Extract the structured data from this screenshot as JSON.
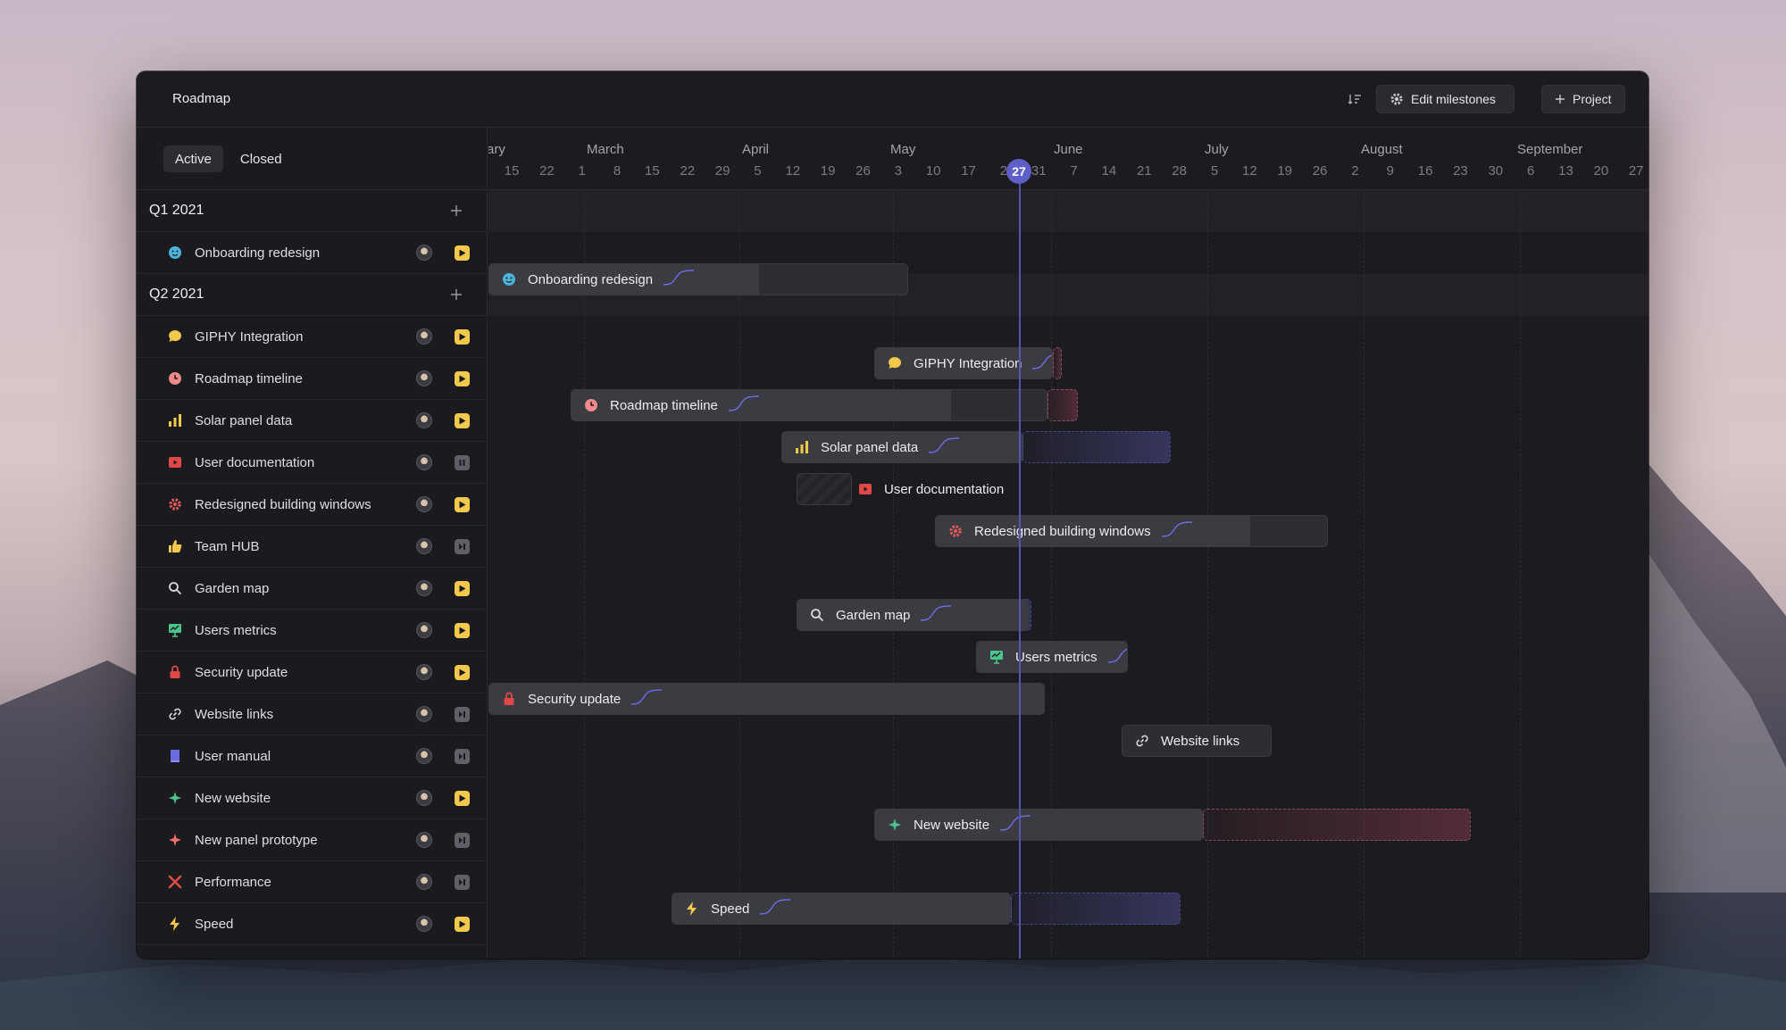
{
  "header": {
    "title": "Roadmap",
    "edit_milestones": "Edit milestones",
    "project": "Project"
  },
  "tabs": [
    {
      "label": "Active",
      "selected": true
    },
    {
      "label": "Closed",
      "selected": false
    }
  ],
  "groups": [
    {
      "label": "Q1 2021"
    },
    {
      "label": "Q2 2021"
    }
  ],
  "items": [
    {
      "label": "Onboarding redesign",
      "icon": "smile-icon",
      "color": "#4fb3d9",
      "status": "play"
    },
    {
      "label": "GIPHY Integration",
      "icon": "chat-bubble-icon",
      "color": "#f2c94c",
      "status": "play"
    },
    {
      "label": "Roadmap timeline",
      "icon": "clock-icon",
      "color": "#f08a8a",
      "status": "play"
    },
    {
      "label": "Solar panel data",
      "icon": "bar-chart-icon",
      "color": "#f2c94c",
      "status": "play"
    },
    {
      "label": "User documentation",
      "icon": "video-icon",
      "color": "#e04848",
      "status": "pause"
    },
    {
      "label": "Redesigned building windows",
      "icon": "gear-icon",
      "color": "#e05a5a",
      "status": "play"
    },
    {
      "label": "Team HUB",
      "icon": "thumbs-up-icon",
      "color": "#f2c94c",
      "status": "skip"
    },
    {
      "label": "Garden map",
      "icon": "search-icon",
      "color": "#d8d8de",
      "status": "play"
    },
    {
      "label": "Users metrics",
      "icon": "presentation-icon",
      "color": "#4cc38a",
      "status": "play"
    },
    {
      "label": "Security update",
      "icon": "lock-icon",
      "color": "#e04848",
      "status": "play"
    },
    {
      "label": "Website links",
      "icon": "link-icon",
      "color": "#d8d8de",
      "status": "skip"
    },
    {
      "label": "User manual",
      "icon": "book-icon",
      "color": "#6b6be0",
      "status": "skip"
    },
    {
      "label": "New website",
      "icon": "plane-icon",
      "color": "#4cc38a",
      "status": "play"
    },
    {
      "label": "New panel prototype",
      "icon": "plane-icon",
      "color": "#f07070",
      "status": "skip"
    },
    {
      "label": "Performance",
      "icon": "tools-icon",
      "color": "#e04848",
      "status": "skip"
    },
    {
      "label": "Speed",
      "icon": "bolt-icon",
      "color": "#f2c94c",
      "status": "play"
    }
  ],
  "timeline": {
    "months": [
      "ary",
      "March",
      "April",
      "May",
      "June",
      "July",
      "August",
      "September"
    ],
    "days": [
      "15",
      "22",
      "1",
      "8",
      "15",
      "22",
      "29",
      "5",
      "12",
      "19",
      "26",
      "3",
      "10",
      "17",
      "2",
      "31",
      "7",
      "14",
      "21",
      "28",
      "5",
      "12",
      "19",
      "26",
      "2",
      "9",
      "16",
      "23",
      "30",
      "6",
      "13",
      "20",
      "27"
    ],
    "today": "27",
    "accent": "#5e5ec9"
  },
  "bars": [
    {
      "label": "Onboarding redesign"
    },
    {
      "label": "GIPHY Integration"
    },
    {
      "label": "Roadmap timeline"
    },
    {
      "label": "Solar panel data"
    },
    {
      "label": "User documentation"
    },
    {
      "label": "Redesigned building windows"
    },
    {
      "label": "Garden map"
    },
    {
      "label": "Users metrics"
    },
    {
      "label": "Security update"
    },
    {
      "label": "Website links"
    },
    {
      "label": "New website"
    },
    {
      "label": "Speed"
    }
  ]
}
